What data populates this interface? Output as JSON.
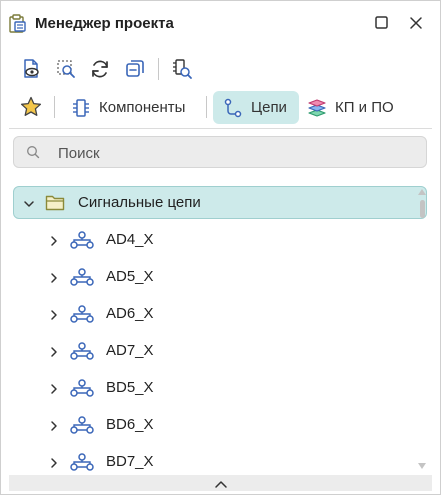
{
  "window": {
    "title": "Менеджер проекта",
    "icons": {
      "app": "project-manager-icon",
      "maximize": "maximize-icon",
      "close": "close-icon"
    }
  },
  "toolbar": {
    "buttons": [
      {
        "name": "view-document-button",
        "icon": "document-eye-icon"
      },
      {
        "name": "select-preview-button",
        "icon": "select-search-icon"
      },
      {
        "name": "refresh-button",
        "icon": "refresh-icon"
      },
      {
        "name": "collapse-all-button",
        "icon": "collapse-icon"
      },
      {
        "name": "find-component-button",
        "icon": "component-search-icon"
      }
    ]
  },
  "tabs": [
    {
      "id": "components",
      "label": "Компоненты",
      "icon": "component-icon",
      "active": false
    },
    {
      "id": "nets",
      "label": "Цепи",
      "icon": "net-icon",
      "active": true
    },
    {
      "id": "kp",
      "label": "КП и ПО",
      "icon": "layers-icon",
      "active": false
    }
  ],
  "search": {
    "placeholder": "Поиск",
    "icon": "search-icon"
  },
  "tree": {
    "root": {
      "label": "Сигнальные цепи",
      "expanded": true
    },
    "items": [
      {
        "label": "AD4_X"
      },
      {
        "label": "AD5_X"
      },
      {
        "label": "AD6_X"
      },
      {
        "label": "AD7_X"
      },
      {
        "label": "BD5_X"
      },
      {
        "label": "BD6_X"
      },
      {
        "label": "BD7_X"
      }
    ]
  },
  "colors": {
    "accent_bg": "#cdeaea",
    "accent_border": "#9fcfcf",
    "icon_blue": "#3a66b8",
    "folder": "#9a9a4a"
  }
}
